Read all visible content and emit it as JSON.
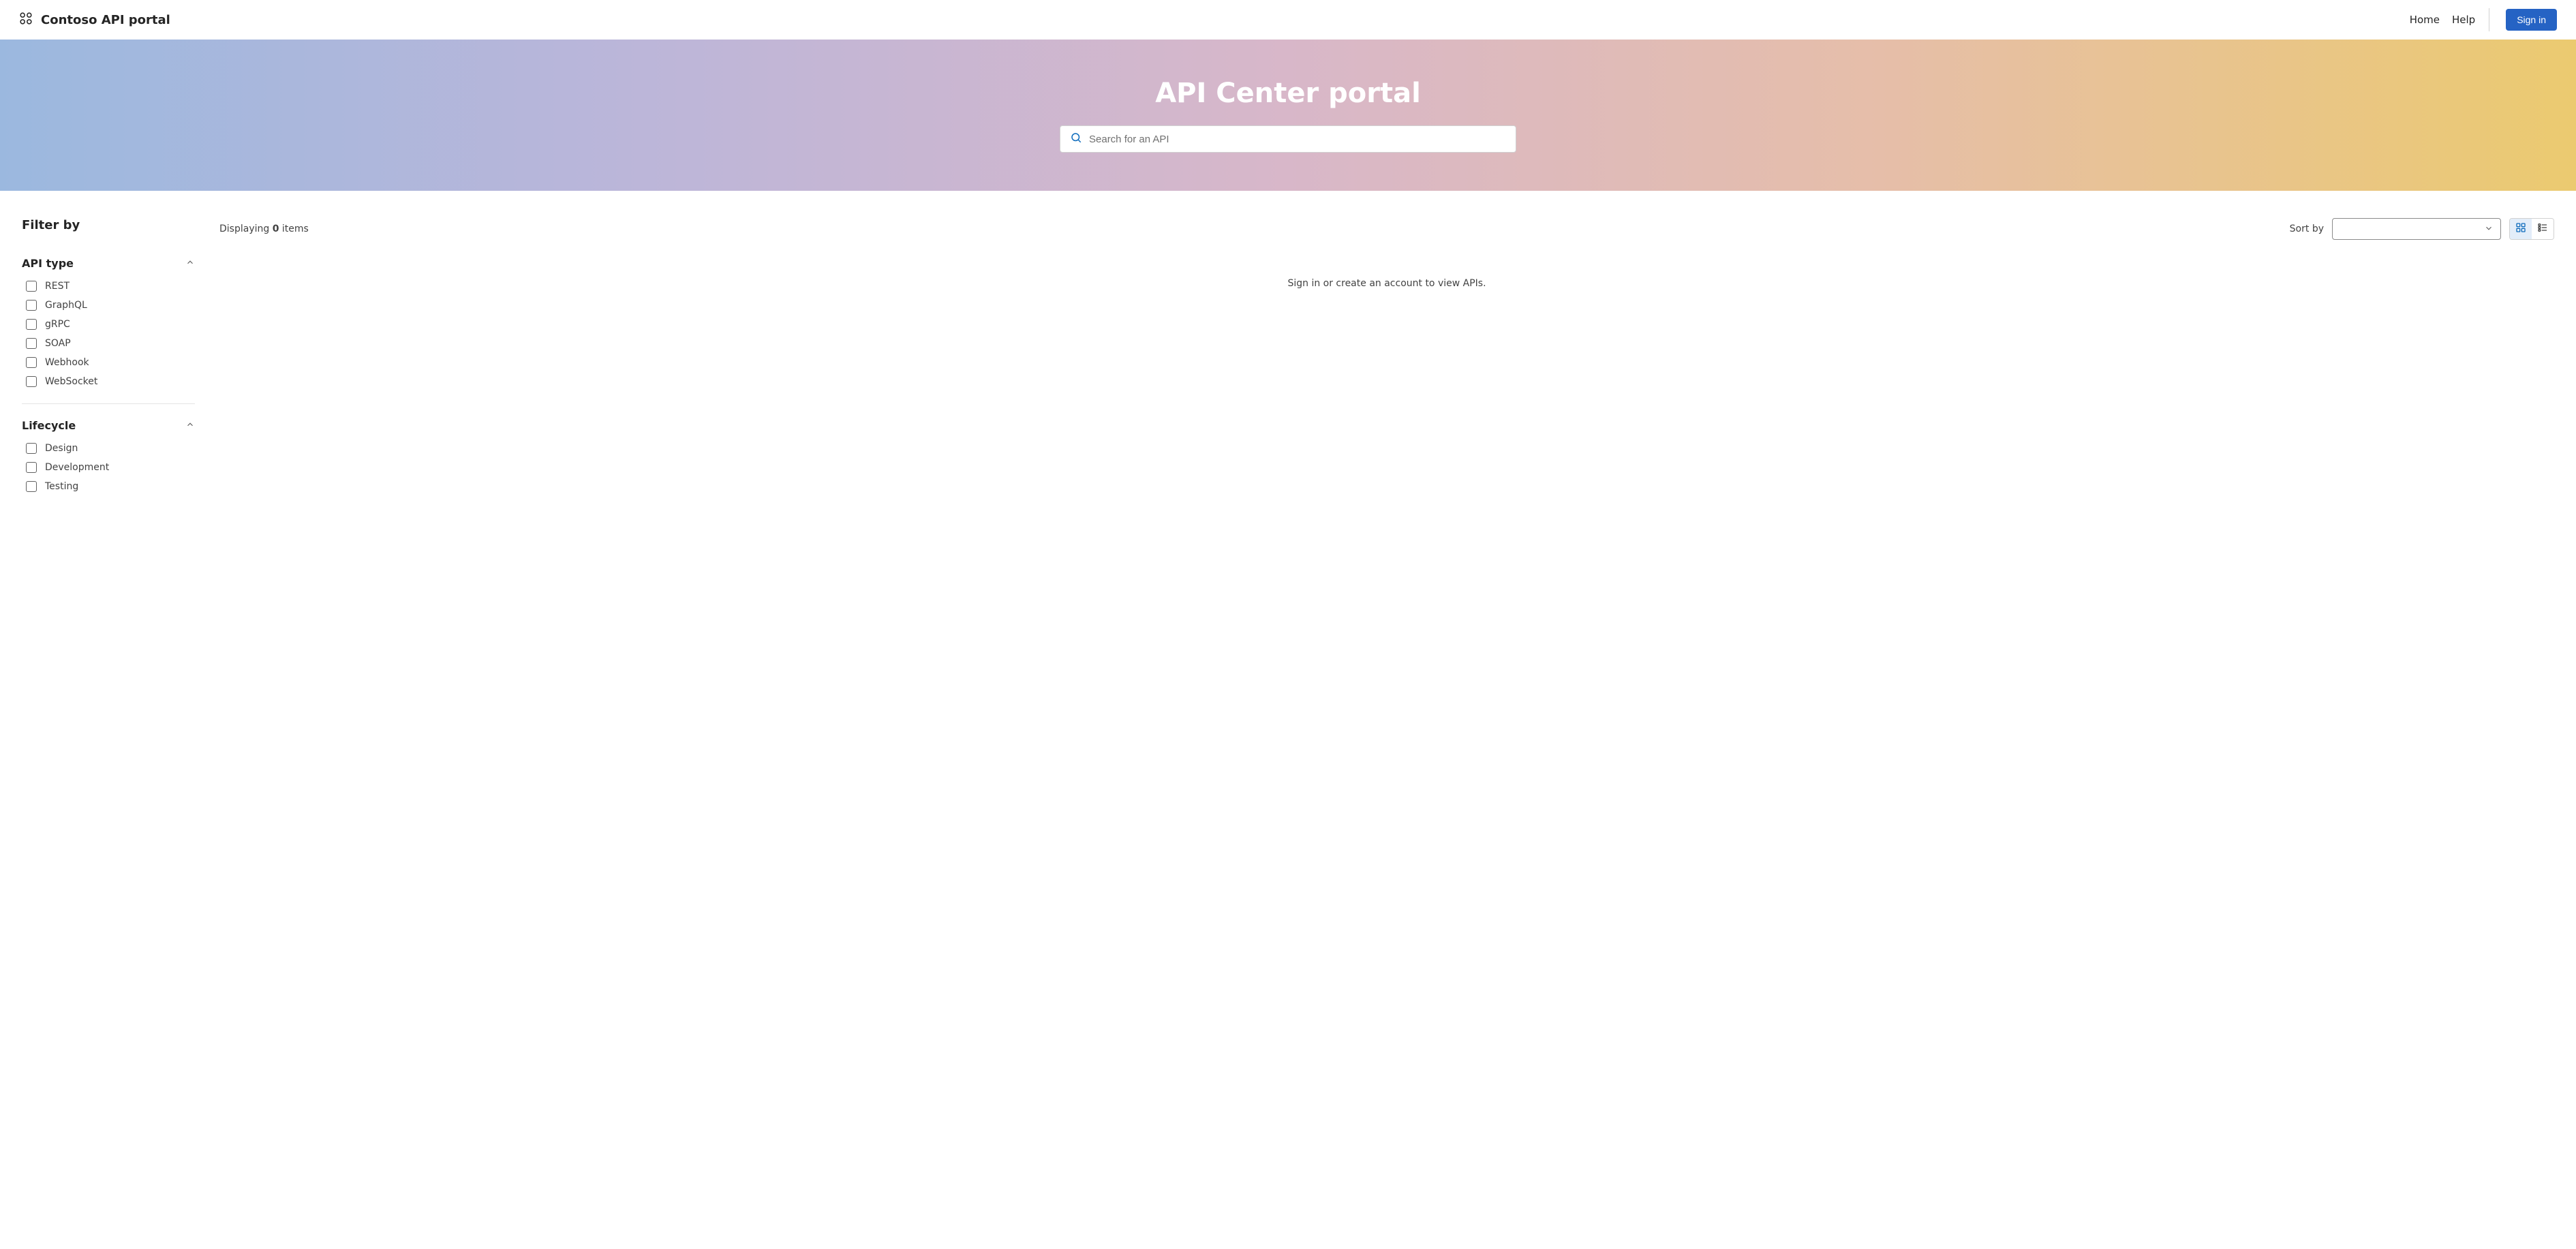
{
  "header": {
    "brand": "Contoso API portal",
    "nav": {
      "home": "Home",
      "help": "Help",
      "sign_in": "Sign in"
    }
  },
  "hero": {
    "title": "API Center portal",
    "search_placeholder": "Search for an API"
  },
  "sidebar": {
    "title": "Filter by",
    "groups": {
      "api_type": {
        "title": "API type",
        "options": [
          "REST",
          "GraphQL",
          "gRPC",
          "SOAP",
          "Webhook",
          "WebSocket"
        ]
      },
      "lifecycle": {
        "title": "Lifecycle",
        "options": [
          "Design",
          "Development",
          "Testing"
        ]
      }
    }
  },
  "main": {
    "displaying_prefix": "Displaying ",
    "displaying_count": "0",
    "displaying_suffix": " items",
    "sort_by_label": "Sort by",
    "empty_message": "Sign in or create an account to view APIs."
  }
}
